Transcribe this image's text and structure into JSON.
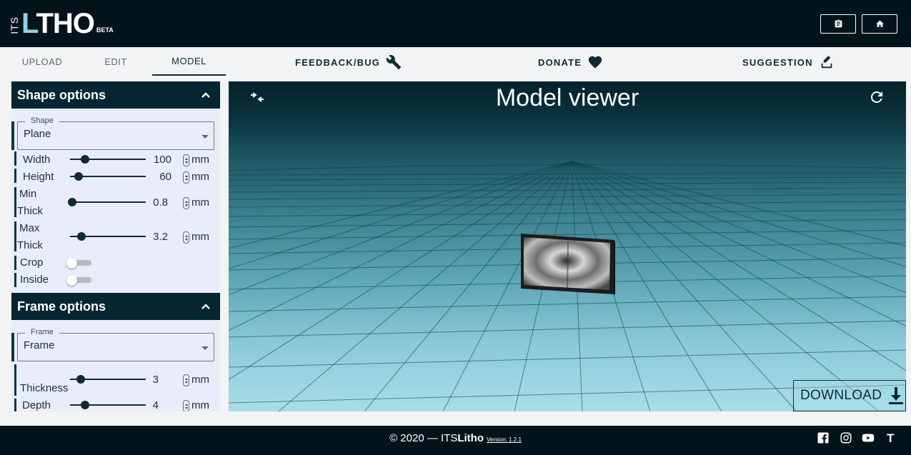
{
  "app": {
    "logo_prefix": "ITS",
    "logo_text": "THO",
    "logo_flame": "L",
    "logo_beta": "BETA"
  },
  "header": {
    "notes_icon": "clipboard-icon",
    "home_icon": "home-icon"
  },
  "nav": {
    "tabs": [
      {
        "label": "UPLOAD",
        "active": false
      },
      {
        "label": "EDIT",
        "active": false
      },
      {
        "label": "MODEL",
        "active": true
      }
    ],
    "links": [
      {
        "label": "FEEDBACK/BUG",
        "icon": "wrench-icon"
      },
      {
        "label": "DONATE",
        "icon": "heart-icon"
      },
      {
        "label": "SUGGESTION",
        "icon": "pencil-box-icon"
      }
    ]
  },
  "shape_options": {
    "title": "Shape options",
    "shape_select": {
      "legend": "Shape",
      "value": "Plane"
    },
    "rows": [
      {
        "label": "Width",
        "value": "100",
        "unit": "mm",
        "fraction": 0.2
      },
      {
        "label": "Height",
        "value": "60",
        "unit": "mm",
        "fraction": 0.12
      },
      {
        "label_line1": "Min",
        "label_line2": "Thick",
        "value": "0.8",
        "unit": "mm",
        "fraction": 0.0
      },
      {
        "label_line1": "Max",
        "label_line2": "Thick",
        "value": "3.2",
        "unit": "mm",
        "fraction": 0.15
      }
    ],
    "toggles": [
      {
        "label": "Crop",
        "on": false
      },
      {
        "label": "Inside",
        "on": false
      }
    ]
  },
  "frame_options": {
    "title": "Frame options",
    "frame_select": {
      "legend": "Frame",
      "value": "Frame"
    },
    "rows": [
      {
        "label": "Thickness",
        "value": "3",
        "unit": "mm",
        "fraction": 0.15
      },
      {
        "label": "Depth",
        "value": "4",
        "unit": "mm",
        "fraction": 0.2
      }
    ]
  },
  "viewer": {
    "title": "Model viewer",
    "download_label": "DOWNLOAD"
  },
  "footer": {
    "copyright_prefix": "© 2020 — ITS",
    "copyright_bold": "Litho",
    "version": "Version: 1.2.1",
    "social": [
      "facebook-icon",
      "instagram-icon",
      "youtube-icon",
      "thingiverse-icon"
    ],
    "thingiverse_glyph": "T"
  },
  "colors": {
    "header_bg": "#02141b",
    "accent": "#042631",
    "panel_bg": "#e9edfa"
  }
}
